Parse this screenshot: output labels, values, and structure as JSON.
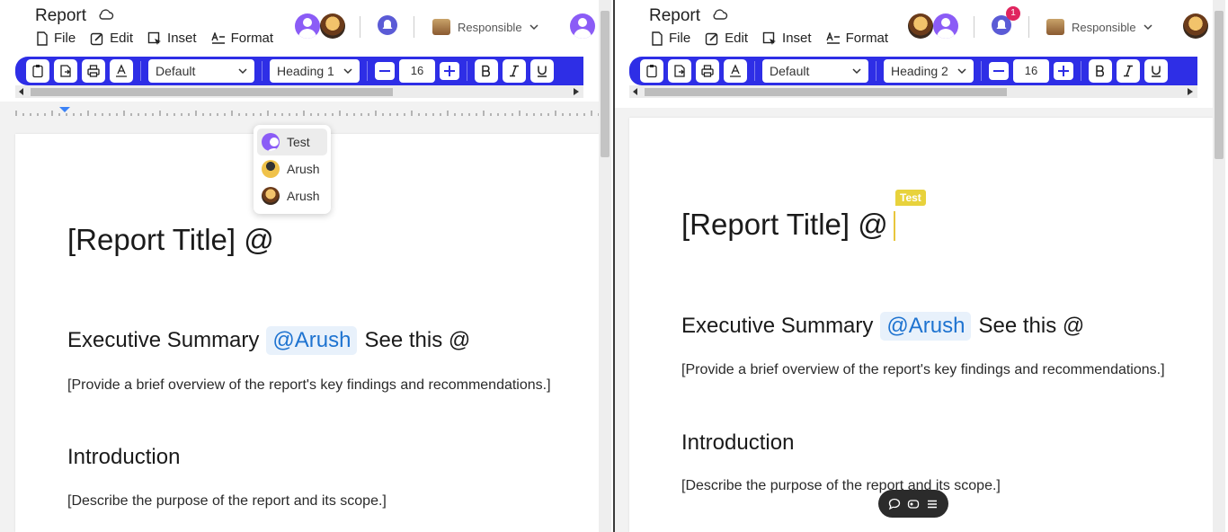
{
  "left": {
    "title": "Report",
    "menu": [
      "File",
      "Edit",
      "Inset",
      "Format"
    ],
    "collab_label": "Responsible",
    "style_select": "Default",
    "heading_select": "Heading 1",
    "font_size": "16",
    "doc": {
      "title": "[Report Title] @",
      "h_exec": "Executive Summary",
      "mention": "@Arush",
      "see_this": "See this @",
      "p_exec": "[Provide a brief overview of the report's key findings and recommendations.]",
      "h_intro": "Introduction",
      "p_intro": "[Describe the purpose of the report and its scope.]"
    },
    "mention_popup": [
      "Test",
      "Arush",
      "Arush"
    ]
  },
  "right": {
    "title": "Report",
    "menu": [
      "File",
      "Edit",
      "Inset",
      "Format"
    ],
    "collab_label": "Responsible",
    "notification_count": "1",
    "style_select": "Default",
    "heading_select": "Heading 2",
    "font_size": "16",
    "cursor_tag": "Test",
    "doc": {
      "title": "[Report Title] @",
      "h_exec": "Executive Summary",
      "mention": "@Arush",
      "see_this": "See this @",
      "p_exec": "[Provide a brief overview of the report's key findings and recommendations.]",
      "h_intro": "Introduction",
      "p_intro": "[Describe the purpose of the report and its scope.]"
    }
  },
  "colors": {
    "toolbar": "#2e2ee6",
    "mention_bg": "#e8f1fb",
    "mention_text": "#1e73d0",
    "cursor": "#e8d23c",
    "badge": "#e0245e"
  }
}
